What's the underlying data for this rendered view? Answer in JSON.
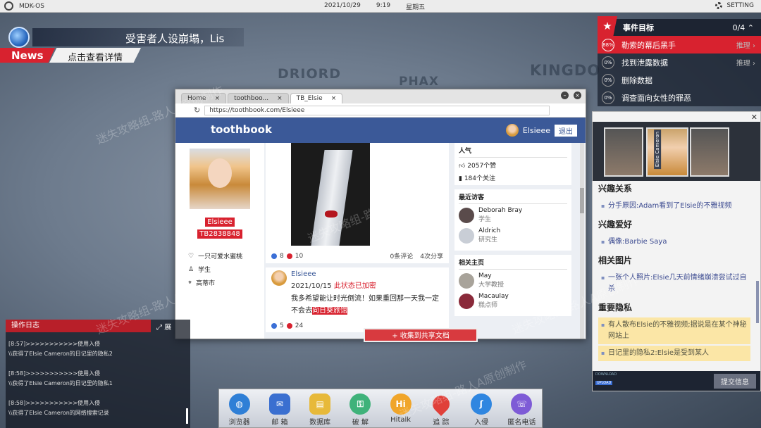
{
  "topbar": {
    "os_name": "MDK-OS",
    "date": "2021/10/29",
    "time": "9:19",
    "weekday": "星期五",
    "setting": "SETTING"
  },
  "map": {
    "label1": "DRIORD",
    "label2": "PHAX",
    "label3": "KINGDO"
  },
  "news": {
    "headline": "受害者人设崩塌，Lis",
    "tag": "News",
    "detail": "点击查看详情"
  },
  "browser": {
    "tabs": [
      {
        "label": "Home"
      },
      {
        "label": "toothboo..."
      },
      {
        "label": "TB_Elsie"
      }
    ],
    "url": "https://toothbook.com/Elsieee",
    "logo": "toothbook",
    "username": "Elsieee",
    "logout": "退出",
    "profile": {
      "name": "Elsieee",
      "id": "TB2838848",
      "bio": "一只可爱水蜜桃",
      "job": "学生",
      "city": "高蒂市"
    },
    "post1": {
      "likes": "8",
      "hearts": "10",
      "comments": "0条评论",
      "shares": "4次分享"
    },
    "post2": {
      "name": "Elsieee",
      "date": "2021/10/15",
      "status": "此状态已加密",
      "text_a": "我多希望能让时光倒流！如果重回那一天我一定不会去",
      "text_hl": "向日葵旅馆",
      "likes": "5",
      "hearts": "24"
    },
    "popularity": {
      "title": "人气",
      "likes": "2057个赞",
      "follows": "184个关注"
    },
    "visitors": {
      "title": "最近访客",
      "items": [
        {
          "name": "Deborah Bray",
          "role": "学生"
        },
        {
          "name": "Aldrich",
          "role": "研究生"
        }
      ]
    },
    "related": {
      "title": "相关主页",
      "items": [
        {
          "name": "May",
          "role": "大学教授"
        },
        {
          "name": "Macaulay",
          "role": "糕点师"
        }
      ]
    }
  },
  "collect_button": "+ 收集到共享文档",
  "events": {
    "title": "事件目标",
    "count": "0/4",
    "items": [
      {
        "pct": "88%",
        "label": "勒索的幕后黑手",
        "hint": "推理"
      },
      {
        "pct": "0%",
        "label": "找到泄露数据",
        "hint": "推理"
      },
      {
        "pct": "0%",
        "label": "删除数据",
        "hint": ""
      },
      {
        "pct": "0%",
        "label": "调查面向女性的罪恶",
        "hint": ""
      }
    ]
  },
  "dossier": {
    "photo_caption": "Elsie Cameron",
    "sec0_title": "兴趣关系",
    "sec0_item": "分手原因:Adam看到了Elsie的不雅视频",
    "sec1_title": "兴趣爱好",
    "sec1_item": "偶像:Barbie Saya",
    "sec2_title": "相关图片",
    "sec2_item": "一张个人照片:Elsie几天前情绪崩溃尝试过自杀",
    "sec3_title": "重要隐私",
    "sec3_items": [
      "有人散布Elsie的不雅视频;据说是在某个神秘网站上",
      "日记里的隐私2:Elsie是受到某人"
    ],
    "download": "DOWNLOAD",
    "upload": "UPLOAD",
    "submit": "提交信息"
  },
  "log": {
    "title": "操作日志",
    "expand": "展",
    "entries": [
      {
        "line1": "[8:57]>>>>>>>>>>>使用入侵",
        "line2": "\\\\获得了Elsie Cameron的日记里的隐私2"
      },
      {
        "line1": "[8:58]>>>>>>>>>>>使用入侵",
        "line2": "\\\\获得了Elsie Cameron的日记里的隐私1"
      },
      {
        "line1": "[8:58]>>>>>>>>>>>使用入侵",
        "line2": "\\\\获得了Elsie Cameron的网络搜索记录"
      }
    ]
  },
  "dock": [
    {
      "label": "浏览器",
      "icon": "globe-icon",
      "color": "#2f7fd6"
    },
    {
      "label": "邮 箱",
      "icon": "mail-icon",
      "color": "#3a6fd0"
    },
    {
      "label": "数据库",
      "icon": "database-icon",
      "color": "#e7b93a"
    },
    {
      "label": "破 解",
      "icon": "key-icon",
      "color": "#3fb27a"
    },
    {
      "label": "Hitalk",
      "icon": "chat-icon",
      "color": "#f0a52a"
    },
    {
      "label": "追 踪",
      "icon": "location-pin-icon",
      "color": "#e0403a"
    },
    {
      "label": "入侵",
      "icon": "hook-icon",
      "color": "#2f86e0"
    },
    {
      "label": "匿名电话",
      "icon": "phone-icon",
      "color": "#7e5bd6"
    }
  ],
  "watermark": "迷失攻略组-路人A原创制作"
}
